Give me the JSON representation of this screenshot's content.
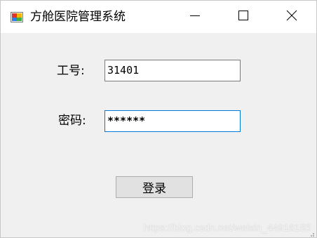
{
  "window": {
    "title": "方舱医院管理系统",
    "icon": "app-window-icon",
    "controls": {
      "minimize": "minimize-icon",
      "maximize": "maximize-icon",
      "close": "close-icon"
    }
  },
  "form": {
    "employee_id_label": "工号:",
    "employee_id_value": "31401",
    "password_label": "密码:",
    "password_value": "******",
    "login_label": "登录"
  },
  "watermark": "https://blog.csdn.net/weixin_44916185",
  "colors": {
    "client_bg": "#f0f0f0",
    "titlebar_bg": "#ffffff",
    "focus_border": "#0078d7",
    "button_bg": "#e1e1e1"
  }
}
